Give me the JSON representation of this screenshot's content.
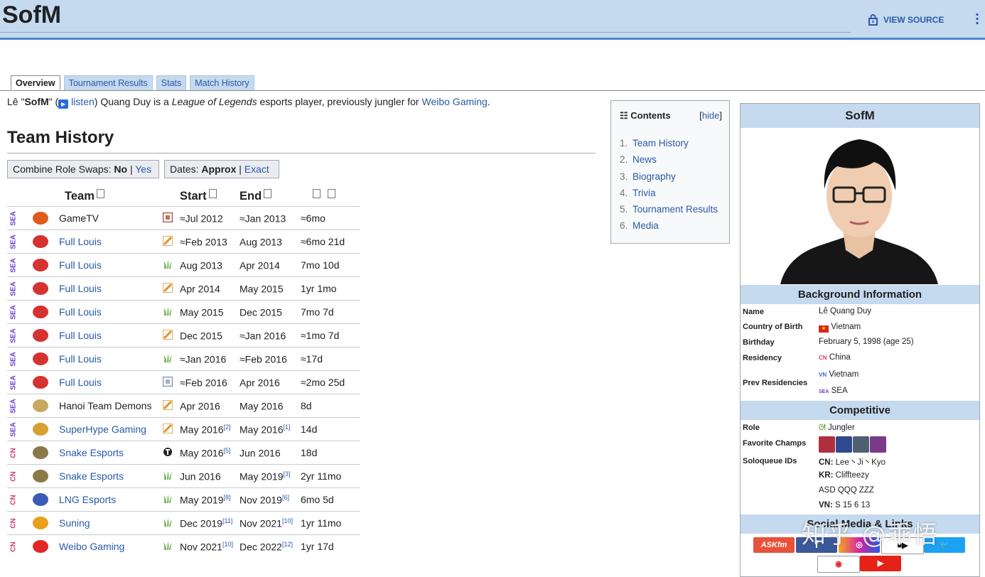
{
  "page": {
    "title": "SofM",
    "view_source": "VIEW SOURCE"
  },
  "tabs": [
    "Overview",
    "Tournament Results",
    "Stats",
    "Match History"
  ],
  "intro": {
    "pre": "Lê \"",
    "bold": "SofM",
    "mid": "\" (",
    "listen": "listen",
    "mid2": ") Quang Duy is a ",
    "game": "League of Legends",
    "mid3": " esports player, previously jungler for ",
    "team": "Weibo Gaming",
    "end": "."
  },
  "section_title": "Team History",
  "toggles": {
    "role_label": "Combine Role Swaps:",
    "role_no": "No",
    "role_yes": "Yes",
    "dates_label": "Dates:",
    "dates_approx": "Approx",
    "dates_exact": "Exact"
  },
  "table": {
    "headers": {
      "team": "Team",
      "start": "Start",
      "end": "End"
    },
    "rows": [
      {
        "region": "SEA",
        "team": "GameTV",
        "linked": false,
        "logo_color": "#e05a1c",
        "role": "support",
        "start": "≈Jul 2012",
        "start_ref": "",
        "end": "≈Jan 2013",
        "end_ref": "",
        "dur": "≈6mo"
      },
      {
        "region": "SEA",
        "team": "Full Louis",
        "linked": true,
        "logo_color": "#d63232",
        "role": "mid",
        "start": "≈Feb 2013",
        "start_ref": "",
        "end": "Aug 2013",
        "end_ref": "",
        "dur": "≈6mo 21d"
      },
      {
        "region": "SEA",
        "team": "Full Louis",
        "linked": true,
        "logo_color": "#d63232",
        "role": "jungle",
        "start": "Aug 2013",
        "start_ref": "",
        "end": "Apr 2014",
        "end_ref": "",
        "dur": "7mo 10d"
      },
      {
        "region": "SEA",
        "team": "Full Louis",
        "linked": true,
        "logo_color": "#d63232",
        "role": "mid",
        "start": "Apr 2014",
        "start_ref": "",
        "end": "May 2015",
        "end_ref": "",
        "dur": "1yr 1mo"
      },
      {
        "region": "SEA",
        "team": "Full Louis",
        "linked": true,
        "logo_color": "#d63232",
        "role": "jungle",
        "start": "May 2015",
        "start_ref": "",
        "end": "Dec 2015",
        "end_ref": "",
        "dur": "7mo 7d"
      },
      {
        "region": "SEA",
        "team": "Full Louis",
        "linked": true,
        "logo_color": "#d63232",
        "role": "mid",
        "start": "Dec 2015",
        "start_ref": "",
        "end": "≈Jan 2016",
        "end_ref": "",
        "dur": "≈1mo 7d"
      },
      {
        "region": "SEA",
        "team": "Full Louis",
        "linked": true,
        "logo_color": "#d63232",
        "role": "jungle",
        "start": "≈Jan 2016",
        "start_ref": "",
        "end": "≈Feb 2016",
        "end_ref": "",
        "dur": "≈17d"
      },
      {
        "region": "SEA",
        "team": "Full Louis",
        "linked": true,
        "logo_color": "#d63232",
        "role": "support2",
        "start": "≈Feb 2016",
        "start_ref": "",
        "end": "Apr 2016",
        "end_ref": "",
        "dur": "≈2mo 25d"
      },
      {
        "region": "SEA",
        "team": "Hanoi Team Demons",
        "linked": false,
        "logo_color": "#c8a860",
        "role": "mid",
        "start": "Apr 2016",
        "start_ref": "",
        "end": "May 2016",
        "end_ref": "",
        "dur": "8d"
      },
      {
        "region": "SEA",
        "team": "SuperHype Gaming",
        "linked": true,
        "logo_color": "#d6a032",
        "role": "mid",
        "start": "May 2016",
        "start_ref": "[2]",
        "end": "May 2016",
        "end_ref": "[1]",
        "dur": "14d"
      },
      {
        "region": "CN",
        "team": "Snake Esports",
        "linked": true,
        "logo_color": "#8a7a4a",
        "role": "coach",
        "start": "May 2016",
        "start_ref": "[5]",
        "end": "Jun 2016",
        "end_ref": "",
        "dur": "18d"
      },
      {
        "region": "CN",
        "team": "Snake Esports",
        "linked": true,
        "logo_color": "#8a7a4a",
        "role": "jungle",
        "start": "Jun 2016",
        "start_ref": "",
        "end": "May 2019",
        "end_ref": "[3]",
        "dur": "2yr 11mo"
      },
      {
        "region": "CN",
        "team": "LNG Esports",
        "linked": true,
        "logo_color": "#3b5bb8",
        "role": "jungle",
        "start": "May 2019",
        "start_ref": "[8]",
        "end": "Nov 2019",
        "end_ref": "[6]",
        "dur": "6mo 5d"
      },
      {
        "region": "CN",
        "team": "Suning",
        "linked": true,
        "logo_color": "#e8a020",
        "role": "jungle",
        "start": "Dec 2019",
        "start_ref": "[11]",
        "end": "Nov 2021",
        "end_ref": "[10]",
        "dur": "1yr 11mo"
      },
      {
        "region": "CN",
        "team": "Weibo Gaming",
        "linked": true,
        "logo_color": "#e02828",
        "role": "jungle",
        "start": "Nov 2021",
        "start_ref": "[10]",
        "end": "Dec 2022",
        "end_ref": "[12]",
        "dur": "1yr 17d"
      }
    ]
  },
  "toc": {
    "title": "Contents",
    "hide": "hide",
    "items": [
      {
        "num": "1.",
        "label": "Team History"
      },
      {
        "num": "2.",
        "label": "News"
      },
      {
        "num": "3.",
        "label": "Biography"
      },
      {
        "num": "4.",
        "label": "Trivia"
      },
      {
        "num": "5.",
        "label": "Tournament Results"
      },
      {
        "num": "6.",
        "label": "Media"
      }
    ]
  },
  "infobox": {
    "name_header": "SofM",
    "bg_header": "Background Information",
    "comp_header": "Competitive",
    "social_header": "Social Media & Links",
    "name_label": "Name",
    "name_value": "Lê Quang Duy",
    "country_label": "Country of Birth",
    "country_value": "Vietnam",
    "birthday_label": "Birthday",
    "birthday_value": "February 5, 1998 (age 25)",
    "residency_label": "Residency",
    "residency_region": "CN",
    "residency_value": "China",
    "prev_label": "Prev Residencies",
    "prev_1_region": "VN",
    "prev_1_value": "Vietnam",
    "prev_2_region": "SEA",
    "prev_2_value": "SEA",
    "role_label": "Role",
    "role_value": "Jungler",
    "champs_label": "Favorite Champs",
    "champ_colors": [
      "#b03040",
      "#304a90",
      "#506070",
      "#7a3a8a"
    ],
    "soloq_label": "Soloqueue IDs",
    "soloq_cn_tag": "CN:",
    "soloq_cn": "Lee丶Ji丶Kyo",
    "soloq_kr_tag": "KR:",
    "soloq_kr": "Cliffteezy",
    "soloq_asd": "ASD QQQ ZZZ",
    "soloq_vn_tag": "VN:",
    "soloq_vn": "S 15 6 13",
    "social_askfm": "ASKfm"
  },
  "watermark": "知乎 @乖悟",
  "colors": {
    "link": "#2a5aa8",
    "header_bar": "#c5d9ef",
    "sea": "#6c3fc9",
    "cn": "#d33f6a"
  }
}
